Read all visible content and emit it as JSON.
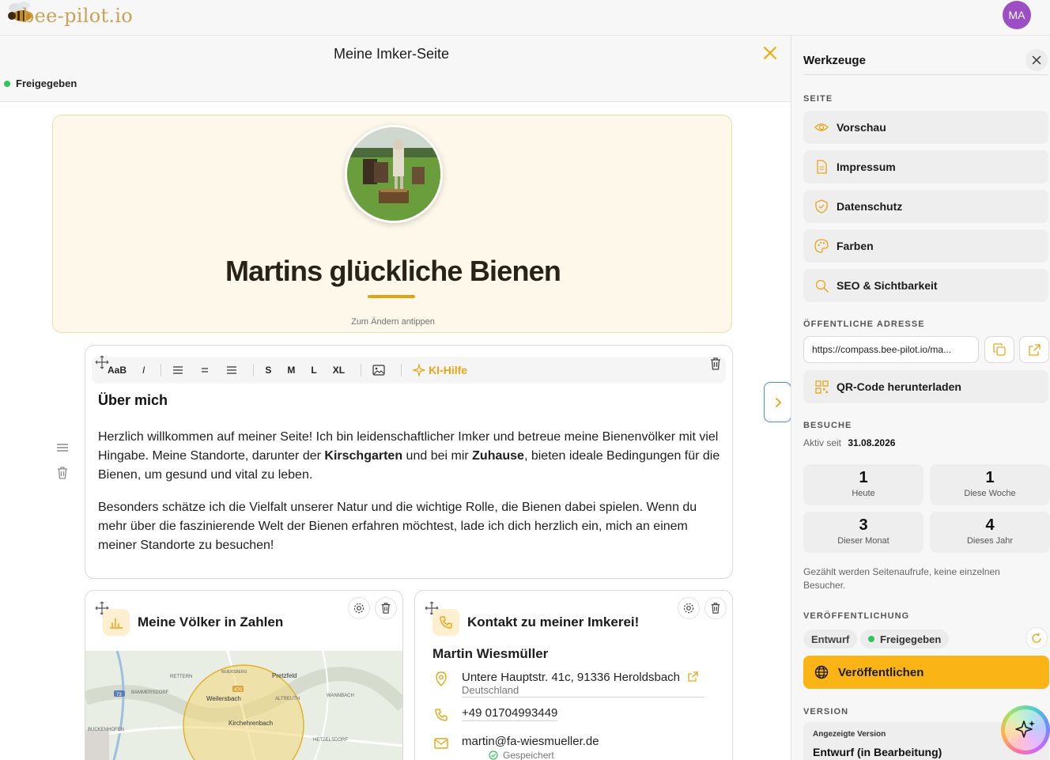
{
  "topbar": {
    "logo_text": "bee-pilot.io",
    "avatar_initials": "MA",
    "avatar_color": "#9c4fc2"
  },
  "editor": {
    "page_title": "Meine Imker-Seite",
    "status": "Freigegeben",
    "status_color": "#2ec55a"
  },
  "hero": {
    "title": "Martins glückliche Bienen",
    "hint": "Zum Ändern antippen",
    "accent": "#e2a211"
  },
  "about": {
    "toolbar": {
      "font_label": "AaB",
      "italic": "I",
      "size_s": "S",
      "size_m": "M",
      "size_l": "L",
      "size_xl": "XL",
      "ki": "KI-Hilfe"
    },
    "heading": "Über mich",
    "p1": [
      {
        "t": "Herzlich willkommen auf meiner Seite! Ich bin leidenschaftlicher Imker und betreue meine Bienenvölker mit viel Hingabe. Meine Standorte, darunter der "
      },
      {
        "t": "Kirschgarten",
        "b": true
      },
      {
        "t": " und bei mir "
      },
      {
        "t": "Zuhause",
        "b": true
      },
      {
        "t": ", bieten ideale Bedingungen für die Bienen, um gesund und vital zu leben."
      }
    ],
    "p2": "Besonders schätze ich die Vielfalt unserer Natur und die wichtige Rolle, die Bienen dabei spielen. Wenn du mehr über die faszinierende Welt der Bienen erfahren möchtest, lade ich dich herzlich ein, mich an einem meiner Standorte zu besuchen!"
  },
  "stats_card": {
    "title": "Meine Völker in Zahlen",
    "map_labels": [
      "RETTERN",
      "BEIERSBERG",
      "Pretzfeld",
      "BAMMERSDORF",
      "Weilersbach",
      "ALTREUTH",
      "WANNBACH",
      "Kirchehrenbach",
      "BUCKENHOFEN",
      "HETZELSDORF",
      "73",
      "470"
    ]
  },
  "contact_card": {
    "title": "Kontakt zu meiner Imkerei!",
    "name": "Martin Wiesmüller",
    "address": "Untere Hauptstr. 41c, 91336 Heroldsbach",
    "country": "Deutschland",
    "phone": "+49 01704993449",
    "email": "martin@fa-wiesmueller.de"
  },
  "saved_status": "Gespeichert",
  "panel": {
    "title": "Werkzeuge",
    "section_page": "SEITE",
    "tools": [
      {
        "label": "Vorschau",
        "icon": "eye-icon"
      },
      {
        "label": "Impressum",
        "icon": "document-icon"
      },
      {
        "label": "Datenschutz",
        "icon": "shield-icon"
      },
      {
        "label": "Farben",
        "icon": "palette-icon"
      },
      {
        "label": "SEO & Sichtbarkeit",
        "icon": "search-icon"
      }
    ],
    "section_address": "ÖFFENTLICHE ADRESSE",
    "url": "https://compass.bee-pilot.io/ma...",
    "qr_label": "QR-Code herunterladen",
    "section_visits": "BESUCHE",
    "active_since_label": "Aktiv seit",
    "active_since_date": "31.08.2026",
    "stats": [
      {
        "value": "1",
        "label": "Heute"
      },
      {
        "value": "1",
        "label": "Diese Woche"
      },
      {
        "value": "3",
        "label": "Dieser Monat"
      },
      {
        "value": "4",
        "label": "Dieses Jahr"
      }
    ],
    "stats_note": "Gezählt werden Seitenaufrufe, keine einzelnen Besucher.",
    "section_publish": "VERÖFFENTLICHUNG",
    "draft_label": "Entwurf",
    "released_label": "Freigegeben",
    "publish_label": "Veröffentlichen",
    "publish_color": "#fbb416",
    "section_version": "VERSION",
    "version_label": "Angezeigte Version",
    "version_value": "Entwurf (in Bearbeitung)"
  }
}
